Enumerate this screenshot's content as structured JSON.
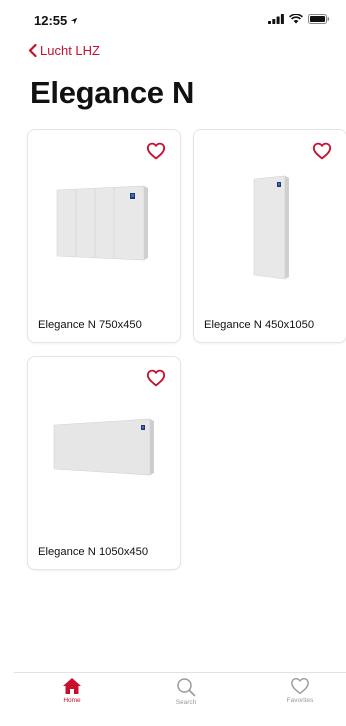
{
  "status_bar": {
    "time": "12:55",
    "location_icon": "location-arrow-icon",
    "icons": [
      "signal-icon",
      "wifi-icon",
      "battery-icon"
    ]
  },
  "nav": {
    "back_label": "Lucht LHZ",
    "title": "Elegance N"
  },
  "products": [
    {
      "name": "Elegance N 750x450",
      "favorite": false
    },
    {
      "name": "Elegance N 450x1050",
      "favorite": false
    },
    {
      "name": "Elegance N 1050x450",
      "favorite": false
    }
  ],
  "tabbar": {
    "tabs": [
      {
        "label": "Home",
        "icon": "home-icon",
        "active": true
      },
      {
        "label": "Search",
        "icon": "search-icon",
        "active": false
      },
      {
        "label": "Favorites",
        "icon": "heart-icon",
        "active": false
      }
    ]
  },
  "colors": {
    "accent": "#c8102e",
    "inactive": "#9a9a9a"
  }
}
